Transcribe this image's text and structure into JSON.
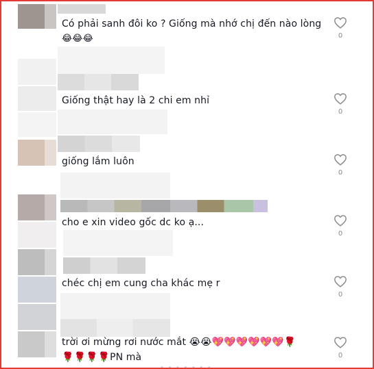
{
  "comments": [
    {
      "text": "Có phải sanh đôi ko ? Giống mà nhớ chị đến nào lòng",
      "emoji_line": "😂😂😂",
      "likes": "0"
    },
    {
      "text": "Giống thật hay là 2 chi em nhỉ",
      "likes": "0"
    },
    {
      "text": "giống lắm luôn",
      "likes": "0"
    },
    {
      "text": "cho e xin video gốc dc ko ạ...",
      "likes": "0"
    },
    {
      "text": "chéc chị em cung cha khác mẹ r",
      "likes": "0"
    },
    {
      "text": "trời ơi mừng rơi nước mắt 😭😭💖💖💖💖💖💖🌹",
      "line2": "🌹🌹🌹🌹PN mà",
      "likes": "0"
    }
  ],
  "footer_cut_text": "- - - - - - -",
  "colors": {
    "frame_border": "#e53935",
    "text": "#161823",
    "count": "#8a8b91"
  },
  "icons": {
    "like": "heart-outline-icon"
  }
}
